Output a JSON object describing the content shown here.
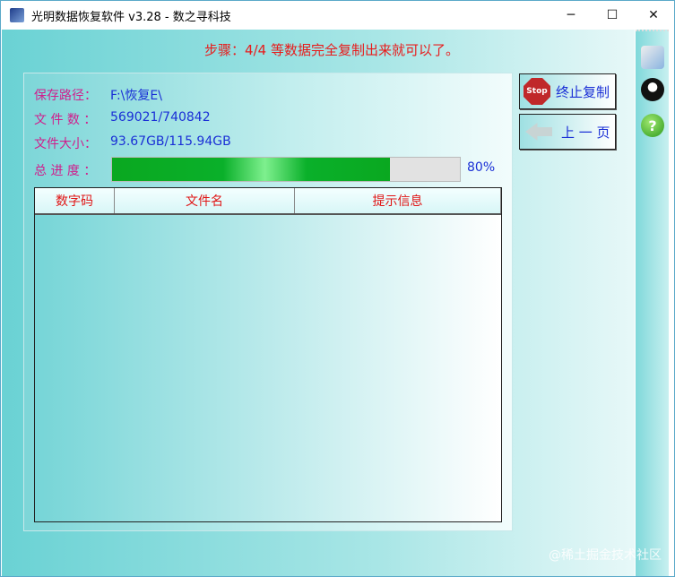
{
  "window": {
    "title": "光明数据恢复软件 v3.28 - 数之寻科技",
    "minimize": "─",
    "maximize": "☐",
    "close": "✕"
  },
  "step": "步骤：4/4 等数据完全复制出来就可以了。",
  "info": {
    "path_label": "保存路径：",
    "path_value": "F:\\恢复E\\",
    "count_label": "文 件 数 ：",
    "count_value": "569021/740842",
    "size_label": "文件大小：",
    "size_value": "93.67GB/115.94GB",
    "progress_label": "总 进 度 ：",
    "progress_percent": 80,
    "progress_text": "80%"
  },
  "table": {
    "columns": [
      "数字码",
      "文件名",
      "提示信息"
    ],
    "rows": []
  },
  "buttons": {
    "stop_icon_text": "Stop",
    "stop": "终止复制",
    "back": "上 一 页"
  },
  "sidebar": {
    "icons": [
      "settings-icon",
      "qq-penguin-icon",
      "help-icon"
    ],
    "help_glyph": "?"
  },
  "watermark": "@稀土掘金技术社区"
}
